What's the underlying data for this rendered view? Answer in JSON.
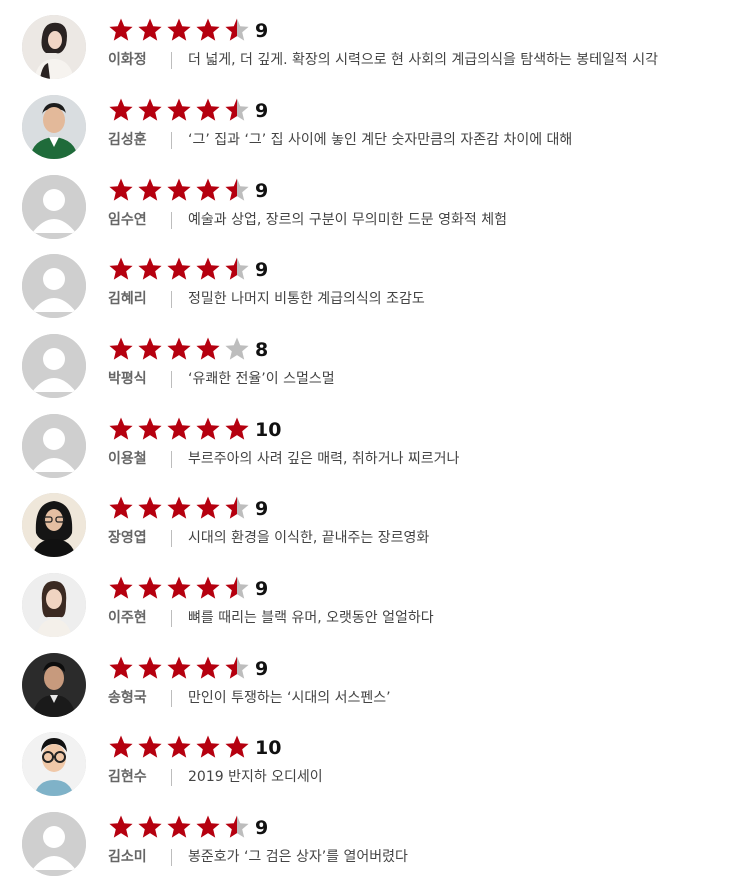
{
  "reviews": [
    {
      "name": "이화정",
      "score": "9",
      "rating": 4.5,
      "comment": "더 넓게, 더 깊게. 확장의 시력으로 현 사회의 계급의식을 탐색하는 봉테일적 시각",
      "avatar": "photo-woman-light"
    },
    {
      "name": "김성훈",
      "score": "9",
      "rating": 4.5,
      "comment": "‘그’ 집과 ‘그’ 집 사이에 놓인 계단 숫자만큼의 자존감 차이에 대해",
      "avatar": "photo-man-green"
    },
    {
      "name": "임수연",
      "score": "9",
      "rating": 4.5,
      "comment": "예술과 상업, 장르의 구분이 무의미한 드문 영화적 체험",
      "avatar": "default"
    },
    {
      "name": "김혜리",
      "score": "9",
      "rating": 4.5,
      "comment": "정밀한 나머지 비통한 계급의식의 조감도",
      "avatar": "default"
    },
    {
      "name": "박평식",
      "score": "8",
      "rating": 4,
      "comment": "‘유쾌한 전율’이 스멀스멀",
      "avatar": "default"
    },
    {
      "name": "이용철",
      "score": "10",
      "rating": 5,
      "comment": "부르주아의 사려 깊은 매력, 취하거나 찌르거나",
      "avatar": "default"
    },
    {
      "name": "장영엽",
      "score": "9",
      "rating": 4.5,
      "comment": "시대의 환경을 이식한, 끝내주는 장르영화",
      "avatar": "photo-woman-dark"
    },
    {
      "name": "이주현",
      "score": "9",
      "rating": 4.5,
      "comment": "뼈를 때리는 블랙 유머, 오랫동안 얼얼하다",
      "avatar": "photo-woman-light2"
    },
    {
      "name": "송형국",
      "score": "9",
      "rating": 4.5,
      "comment": "만인이 투쟁하는 ‘시대의 서스펜스’",
      "avatar": "photo-man-dark"
    },
    {
      "name": "김현수",
      "score": "10",
      "rating": 5,
      "comment": "2019 반지하 오디세이",
      "avatar": "photo-man-glasses"
    },
    {
      "name": "김소미",
      "score": "9",
      "rating": 4.5,
      "comment": "봉준호가 ‘그 검은 상자’를 열어버렸다",
      "avatar": "default"
    }
  ],
  "colors": {
    "star_filled": "#b5000f",
    "star_empty": "#bdbdbd",
    "default_avatar_bg": "#cfcfcf",
    "default_avatar_fg": "#ffffff"
  },
  "icons": {
    "star": "star-icon",
    "default_avatar": "user-silhouette-icon"
  }
}
